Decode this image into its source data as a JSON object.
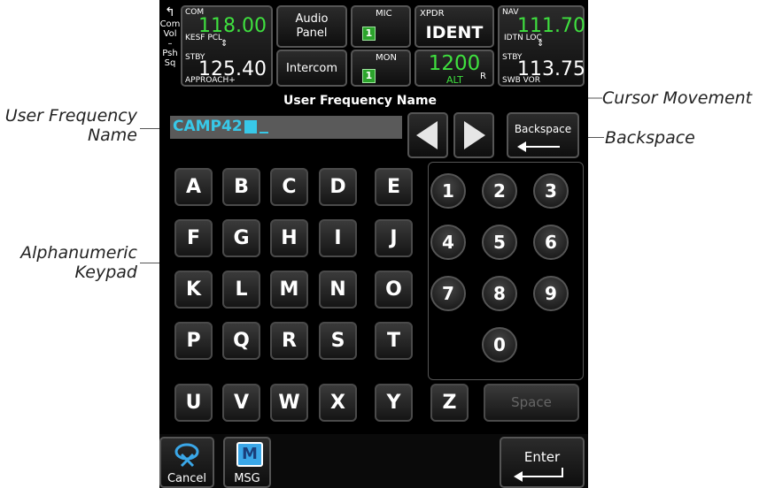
{
  "callouts": {
    "user_frequency_name_line1": "User Frequency",
    "user_frequency_name_line2": "Name",
    "cursor_movement": "Cursor Movement",
    "backspace": "Backspace",
    "alphanumeric_line1": "Alphanumeric",
    "alphanumeric_line2": "Keypad"
  },
  "com_vol": {
    "line1": "Com",
    "line2": "Vol",
    "line3": "–",
    "line4": "Psh",
    "line5": "Sq"
  },
  "com": {
    "label": "COM",
    "active_freq": "118.00",
    "active_id": "KESF PCL",
    "stby_label": "STBY",
    "standby_freq": "125.40",
    "standby_id": "APPROACH+"
  },
  "audio": {
    "audio_line1": "Audio",
    "audio_line2": "Panel",
    "intercom": "Intercom"
  },
  "mic": {
    "mic_label": "MIC",
    "mic_value": "1",
    "mon_label": "MON",
    "mon_value": "1"
  },
  "xpdr": {
    "label": "XPDR",
    "ident": "IDENT",
    "code": "1200",
    "mode": "ALT",
    "reply": "R"
  },
  "nav": {
    "label": "NAV",
    "active_freq": "111.70",
    "active_id": "IDTN LOC",
    "stby_label": "STBY",
    "standby_freq": "113.75",
    "standby_id": "SWB VOR"
  },
  "page_title": "User Frequency Name",
  "name_input": {
    "value": "CAMP42"
  },
  "backspace_button": "Backspace",
  "letters": [
    "A",
    "B",
    "C",
    "D",
    "E",
    "F",
    "G",
    "H",
    "I",
    "J",
    "K",
    "L",
    "M",
    "N",
    "O",
    "P",
    "Q",
    "R",
    "S",
    "T",
    "U",
    "V",
    "W",
    "X",
    "Y",
    "Z"
  ],
  "numbers": [
    "1",
    "2",
    "3",
    "4",
    "5",
    "6",
    "7",
    "8",
    "9",
    "0"
  ],
  "space_button": "Space",
  "bottom": {
    "cancel": "Cancel",
    "msg": "MSG",
    "enter": "Enter"
  },
  "colors": {
    "active_freq": "#3fe03f",
    "input_text": "#38c8e8",
    "input_bg": "#5a5a5a"
  }
}
